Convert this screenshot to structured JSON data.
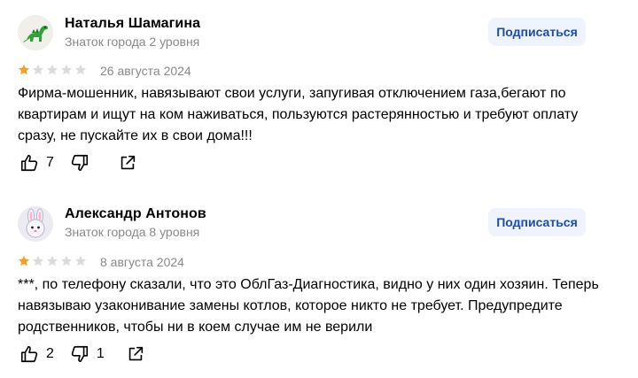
{
  "reviews": [
    {
      "author": "Наталья Шамагина",
      "level": "Знаток города 2 уровня",
      "avatar_icon": "dinosaur-icon",
      "subscribe_label": "Подписаться",
      "rating": 1,
      "date": "26 августа 2024",
      "text": "Фирма-мошенник, навязывают свои услуги, запугивая отключением газа,бегают по квартирам и ищут на ком наживаться, пользуются растерянностью и требуют оплату сразу, не пускайте их в свои дома!!!",
      "likes": "7",
      "dislikes": ""
    },
    {
      "author": "Александр Антонов",
      "level": "Знаток города 8 уровня",
      "avatar_icon": "bunny-icon",
      "subscribe_label": "Подписаться",
      "rating": 1,
      "date": "8 августа 2024",
      "text": "***, по телефону сказали, что это ОблГаз-Диагностика, видно у них один хозяин. Теперь навязываю узаконивание замены котлов, которое никто не требует. Предупредите родственников, чтобы ни в коем случае им не верили",
      "likes": "2",
      "dislikes": "1"
    }
  ],
  "colors": {
    "star_filled": "#fc9d1c",
    "star_empty": "#dcdcdc",
    "subscribe_bg": "#eef3fc",
    "subscribe_text": "#1a4db3",
    "meta_text": "#898989"
  }
}
